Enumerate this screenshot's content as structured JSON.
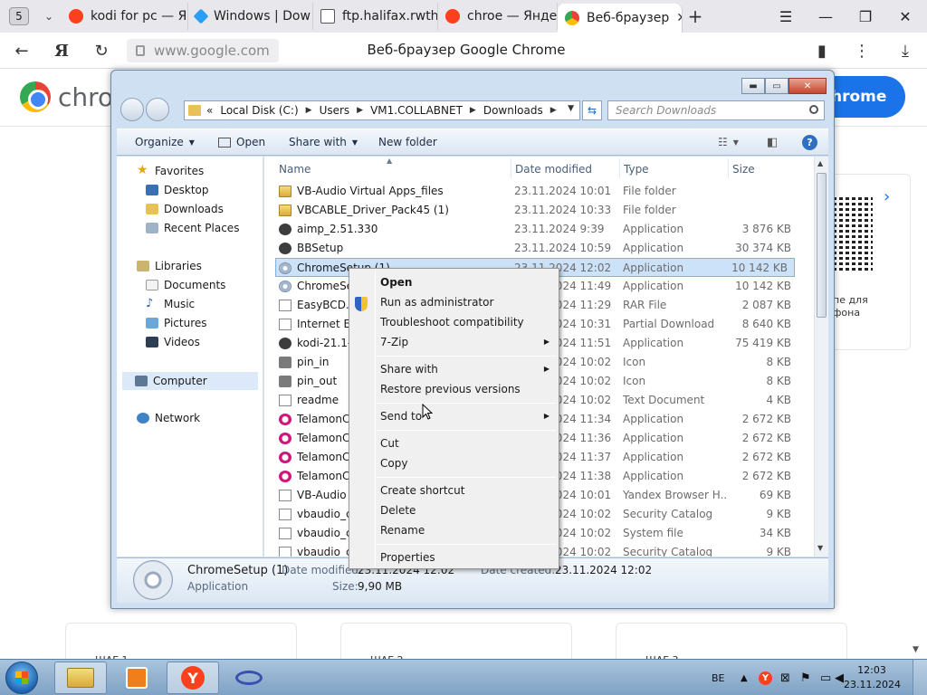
{
  "browser": {
    "tab_count": "5",
    "tabs": [
      {
        "label": "kodi for pc — Ян",
        "favicon_color": "#fc3f1d"
      },
      {
        "label": "Windows | Dow",
        "favicon_color": "#2a9df4"
      },
      {
        "label": "ftp.halifax.rwth",
        "favicon_color": "#555555"
      },
      {
        "label": "chroe — Яндекс",
        "favicon_color": "#fc3f1d"
      },
      {
        "label": "Веб-браузер",
        "favicon_color": "#4285f4"
      }
    ],
    "url": "www.google.com",
    "page_title": "Веб-браузер Google Chrome",
    "yandex_letter": "Я"
  },
  "page": {
    "logo_text": "chrom",
    "download_button": "hrome",
    "side_text": "пе для\nфона",
    "step_labels": [
      "ШАГ 1",
      "ШАГ 2",
      "ШАГ 3"
    ]
  },
  "explorer": {
    "breadcrumb": [
      "Local Disk (C:)",
      "Users",
      "VM1.COLLABNET",
      "Downloads"
    ],
    "breadcrumb_prefix": "«",
    "search_placeholder": "Search Downloads",
    "toolbar": {
      "organize": "Organize",
      "open": "Open",
      "share_with": "Share with",
      "new_folder": "New folder"
    },
    "nav": {
      "favorites": "Favorites",
      "favorites_items": [
        "Desktop",
        "Downloads",
        "Recent Places"
      ],
      "libraries": "Libraries",
      "libraries_items": [
        "Documents",
        "Music",
        "Pictures",
        "Videos"
      ],
      "computer": "Computer",
      "network": "Network"
    },
    "columns": {
      "name": "Name",
      "date": "Date modified",
      "type": "Type",
      "size": "Size"
    },
    "files": [
      {
        "name": "VB-Audio Virtual Apps_files",
        "date": "23.11.2024 10:01",
        "type": "File folder",
        "size": "",
        "icon": "folder"
      },
      {
        "name": "VBCABLE_Driver_Pack45 (1)",
        "date": "23.11.2024 10:33",
        "type": "File folder",
        "size": "",
        "icon": "folder"
      },
      {
        "name": "aimp_2.51.330",
        "date": "23.11.2024 9:39",
        "type": "Application",
        "size": "3 876 KB",
        "icon": "app"
      },
      {
        "name": "BBSetup",
        "date": "23.11.2024 10:59",
        "type": "Application",
        "size": "30 374 KB",
        "icon": "app"
      },
      {
        "name": "ChromeSetup (1)",
        "date": "23.11.2024 12:02",
        "type": "Application",
        "size": "10 142 KB",
        "icon": "installer",
        "selected": true
      },
      {
        "name": "ChromeSetup",
        "date": "23.11.2024 11:49",
        "type": "Application",
        "size": "10 142 KB",
        "icon": "installer"
      },
      {
        "name": "EasyBCD.v2.3",
        "date": "23.11.2024 11:29",
        "type": "RAR File",
        "size": "2 087 KB",
        "icon": "doc"
      },
      {
        "name": "Internet Explorer",
        "date": "23.11.2024 10:31",
        "type": "Partial Download",
        "size": "8 640 KB",
        "icon": "doc"
      },
      {
        "name": "kodi-21.1-Omega",
        "date": "23.11.2024 11:51",
        "type": "Application",
        "size": "75 419 KB",
        "icon": "app"
      },
      {
        "name": "pin_in",
        "date": "23.11.2024 10:02",
        "type": "Icon",
        "size": "8 KB",
        "icon": "icon"
      },
      {
        "name": "pin_out",
        "date": "23.11.2024 10:02",
        "type": "Icon",
        "size": "8 KB",
        "icon": "icon"
      },
      {
        "name": "readme",
        "date": "23.11.2024 10:02",
        "type": "Text Document",
        "size": "4 KB",
        "icon": "doc"
      },
      {
        "name": "TelamonCleaner",
        "date": "23.11.2024 11:34",
        "type": "Application",
        "size": "2 672 KB",
        "icon": "telamon"
      },
      {
        "name": "TelamonCleaner",
        "date": "23.11.2024 11:36",
        "type": "Application",
        "size": "2 672 KB",
        "icon": "telamon"
      },
      {
        "name": "TelamonCleaner",
        "date": "23.11.2024 11:37",
        "type": "Application",
        "size": "2 672 KB",
        "icon": "telamon"
      },
      {
        "name": "TelamonCleaner",
        "date": "23.11.2024 11:38",
        "type": "Application",
        "size": "2 672 KB",
        "icon": "telamon"
      },
      {
        "name": "VB-Audio Virtual",
        "date": "23.11.2024 10:01",
        "type": "Yandex Browser H...",
        "size": "69 KB",
        "icon": "doc"
      },
      {
        "name": "vbaudio_cable64",
        "date": "23.11.2024 10:02",
        "type": "Security Catalog",
        "size": "9 KB",
        "icon": "doc"
      },
      {
        "name": "vbaudio_cable64",
        "date": "23.11.2024 10:02",
        "type": "System file",
        "size": "34 KB",
        "icon": "doc"
      },
      {
        "name": "vbaudio_cable64",
        "date": "23.11.2024 10:02",
        "type": "Security Catalog",
        "size": "9 KB",
        "icon": "doc"
      }
    ],
    "details": {
      "name": "ChromeSetup (1)",
      "type": "Application",
      "date_label": "Date modified:",
      "date_value": "23.11.2024 12:02",
      "size_label": "Size:",
      "size_value": "9,90 MB",
      "created_label": "Date created:",
      "created_value": "23.11.2024 12:02"
    }
  },
  "context_menu": {
    "open": "Open",
    "run_as_admin": "Run as administrator",
    "troubleshoot": "Troubleshoot compatibility",
    "seven_zip": "7-Zip",
    "share_with": "Share with",
    "restore": "Restore previous versions",
    "send_to": "Send to",
    "cut": "Cut",
    "copy": "Copy",
    "create_shortcut": "Create shortcut",
    "delete": "Delete",
    "rename": "Rename",
    "properties": "Properties"
  },
  "taskbar": {
    "language": "BE",
    "time": "12:03",
    "date": "23.11.2024"
  }
}
